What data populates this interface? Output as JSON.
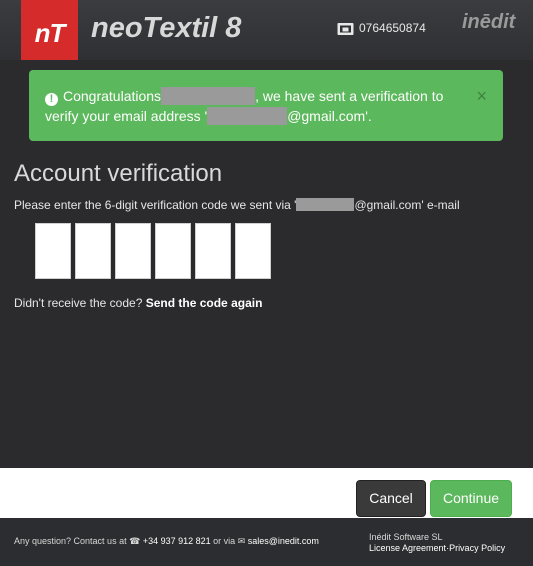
{
  "header": {
    "logo_text": "nT",
    "app_name": "neoTextil 8",
    "phone": "0764650874",
    "brand": "inēdit"
  },
  "alert": {
    "text_1": "Congratulations",
    "text_2": ", we have sent a verification to",
    "text_3": "verify your email address '",
    "text_4": "@gmail.com'.",
    "close": "×",
    "color": "#5cb85c"
  },
  "verify": {
    "title": "Account verification",
    "instr_1": "Please enter the 6-digit verification code we sent via '",
    "instr_2": "@gmail.com' e-mail",
    "code_digits": [
      "",
      "",
      "",
      "",
      "",
      ""
    ],
    "resend_prefix": "Didn't receive the code?",
    "resend_link": "Send the code again"
  },
  "actions": {
    "cancel": "Cancel",
    "continue": "Continue"
  },
  "footer": {
    "contact_prefix": "Any question? Contact us at",
    "phone": "+34 937 912 821",
    "or_via": "or via",
    "email": "sales@inedit.com",
    "company": "Inédit Software SL",
    "license": "License Agreement",
    "privacy": "Privacy Policy"
  }
}
